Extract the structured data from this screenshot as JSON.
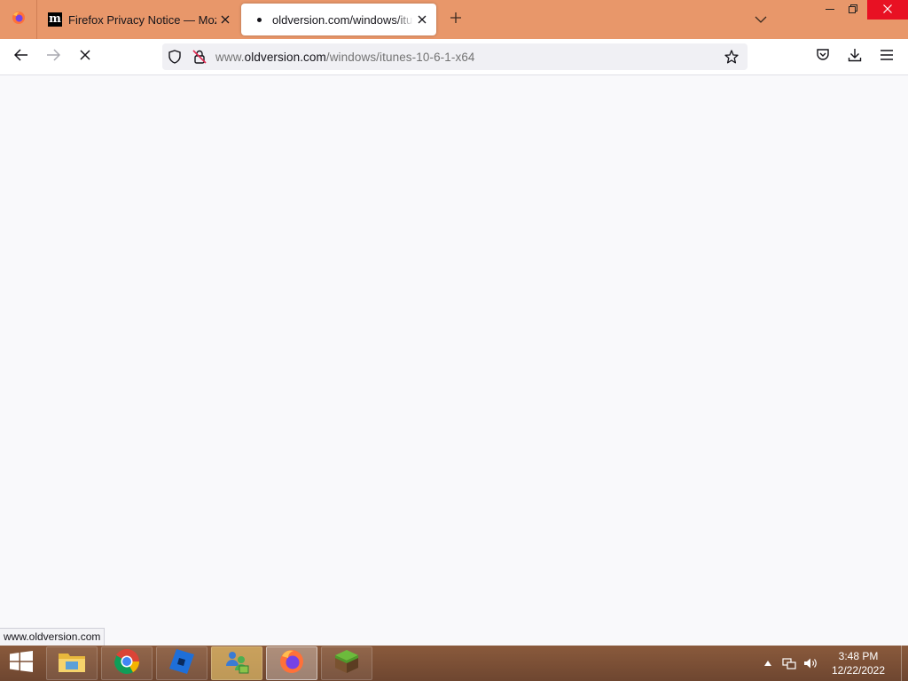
{
  "browser": {
    "tabs": [
      {
        "title": "Firefox Privacy Notice — Mozilla",
        "active": false,
        "favicon": "mozilla-m-icon"
      },
      {
        "title": "oldversion.com/windows/itune",
        "active": true,
        "favicon": "loading-dot-icon"
      }
    ],
    "urlbar": {
      "prefix": "www.",
      "host": "oldversion.com",
      "path": "/windows/itunes-10-6-1-x64"
    },
    "status_text": "www.oldversion.com",
    "theme": {
      "tabstrip": "#e8976a",
      "close_button": "#e81123"
    }
  },
  "taskbar": {
    "pinned": [
      "file-explorer-icon",
      "chrome-icon",
      "roblox-icon",
      "network-users-icon",
      "firefox-icon",
      "minecraft-icon"
    ],
    "clock": {
      "time": "3:48 PM",
      "date": "12/22/2022"
    }
  }
}
